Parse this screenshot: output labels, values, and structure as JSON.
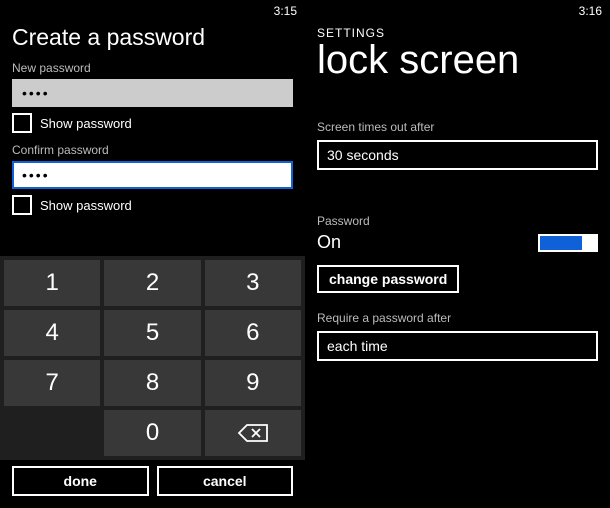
{
  "left": {
    "time": "3:15",
    "title": "Create a password",
    "new_label": "New password",
    "new_value": "••••",
    "confirm_label": "Confirm password",
    "confirm_value": "••••",
    "show_password": "Show password",
    "keys": {
      "1": "1",
      "2": "2",
      "3": "3",
      "4": "4",
      "5": "5",
      "6": "6",
      "7": "7",
      "8": "8",
      "9": "9",
      "0": "0"
    },
    "done": "done",
    "cancel": "cancel"
  },
  "right": {
    "time": "3:16",
    "breadcrumb": "SETTINGS",
    "title": "lock screen",
    "timeout_label": "Screen times out after",
    "timeout_value": "30 seconds",
    "password_label": "Password",
    "password_value": "On",
    "change_password": "change password",
    "require_label": "Require a password after",
    "require_value": "each time"
  }
}
